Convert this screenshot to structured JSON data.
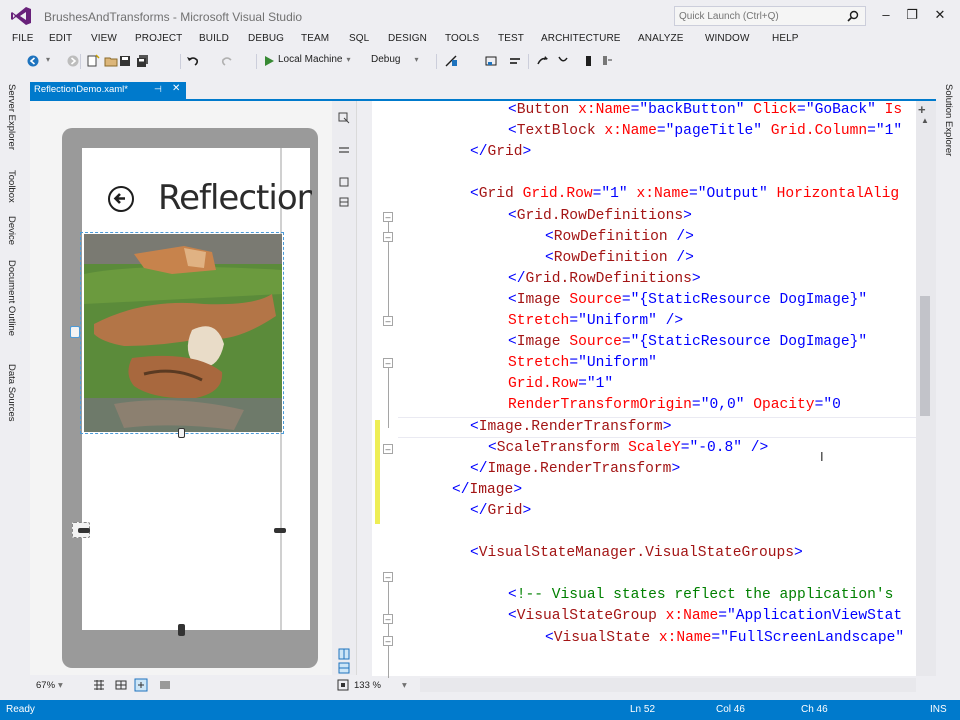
{
  "window": {
    "title": "BrushesAndTransforms - Microsoft Visual Studio",
    "quick_launch_placeholder": "Quick Launch (Ctrl+Q)"
  },
  "menu": [
    "FILE",
    "EDIT",
    "VIEW",
    "PROJECT",
    "BUILD",
    "DEBUG",
    "TEAM",
    "SQL",
    "DESIGN",
    "TOOLS",
    "TEST",
    "ARCHITECTURE",
    "ANALYZE",
    "WINDOW",
    "HELP"
  ],
  "toolbar": {
    "run_target": "Local Machine",
    "configuration": "Debug"
  },
  "left_tool_tabs": [
    "Server Explorer",
    "Toolbox",
    "Device",
    "Document Outline",
    "Data Sources"
  ],
  "right_tool_tabs": [
    "Solution Explorer"
  ],
  "document_tab": {
    "label": "ReflectionDemo.xaml*"
  },
  "designer": {
    "page_title": "ReflectionDemo",
    "zoom": "67%"
  },
  "editor": {
    "zoom": "133 %",
    "lines": [
      "    <Button x:Name=\"backButton\" Click=\"GoBack\" Is",
      "    <TextBlock x:Name=\"pageTitle\" Grid.Column=\"1\"",
      "</Grid>",
      "",
      "<Grid Grid.Row=\"1\" x:Name=\"Output\" HorizontalAlig",
      "    <Grid.RowDefinitions>",
      "        <RowDefinition />",
      "        <RowDefinition />",
      "    </Grid.RowDefinitions>",
      "    <Image Source=\"{StaticResource DogImage}\"",
      "           Stretch=\"Uniform\" />",
      "    <Image Source=\"{StaticResource DogImage}\"",
      "           Stretch=\"Uniform\"",
      "           Grid.Row=\"1\"",
      "           RenderTransformOrigin=\"0,0\" Opacity=\"0",
      "<Image.RenderTransform>",
      "  <ScaleTransform ScaleY=\"-0.8\" />",
      "</Image.RenderTransform>",
      "</Image>",
      "</Grid>",
      "",
      "<VisualStateManager.VisualStateGroups>",
      "",
      "    <!-- Visual states reflect the application's",
      "    <VisualStateGroup x:Name=\"ApplicationViewStat",
      "        <VisualState x:Name=\"FullScreenLandscape\""
    ]
  },
  "status": {
    "state": "Ready",
    "line": "Ln 52",
    "col": "Col 46",
    "ch": "Ch 46",
    "mode": "INS"
  },
  "colors": {
    "accent": "#007acc",
    "tag": "#a31515",
    "attribute": "#ff0000",
    "punctuation": "#0000ff",
    "comment": "#008000"
  }
}
